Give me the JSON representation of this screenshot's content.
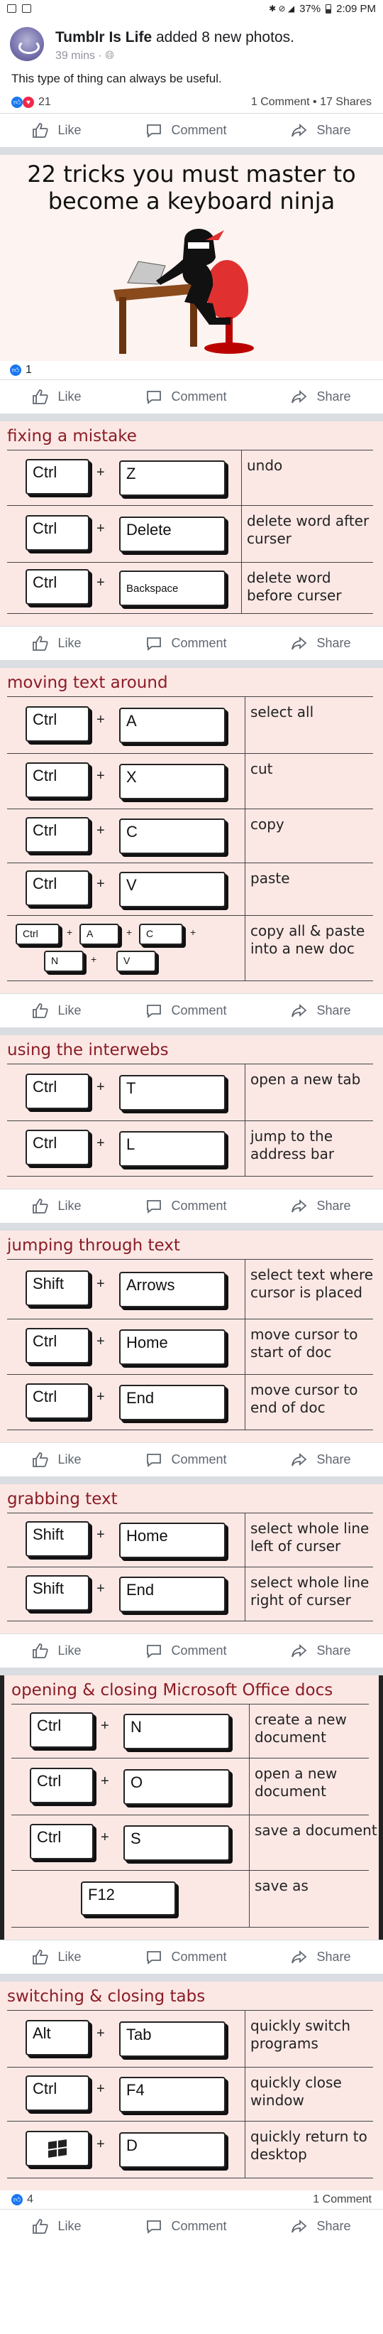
{
  "status_bar": {
    "battery": "37%",
    "time": "2:09 PM"
  },
  "post": {
    "author": "Tumblr Is Life",
    "action": "added 8 new photos.",
    "time": "39 mins · ",
    "text": "This type of thing can always be useful.",
    "reactions": "21",
    "stats": "1 Comment • 17 Shares"
  },
  "actions": {
    "like": "Like",
    "comment": "Comment",
    "share": "Share"
  },
  "banner": {
    "title": "22 tricks you must master to become a keyboard ninja",
    "likes": "1"
  },
  "sections": [
    {
      "title": "fixing a mistake",
      "rows": [
        {
          "keys": [
            "Ctrl",
            "Z"
          ],
          "desc": "undo"
        },
        {
          "keys": [
            "Ctrl",
            "Delete"
          ],
          "desc": "delete word after curser"
        },
        {
          "keys": [
            "Ctrl",
            "Backspace"
          ],
          "desc": "delete word before curser"
        }
      ]
    },
    {
      "title": "moving text around",
      "rows": [
        {
          "keys": [
            "Ctrl",
            "A"
          ],
          "desc": "select all"
        },
        {
          "keys": [
            "Ctrl",
            "X"
          ],
          "desc": "cut"
        },
        {
          "keys": [
            "Ctrl",
            "C"
          ],
          "desc": "copy"
        },
        {
          "keys": [
            "Ctrl",
            "V"
          ],
          "desc": "paste"
        },
        {
          "keys": [
            "Ctrl",
            "A",
            "C",
            "N",
            "V"
          ],
          "desc": "copy all & paste into a new doc"
        }
      ]
    },
    {
      "title": "using the interwebs",
      "rows": [
        {
          "keys": [
            "Ctrl",
            "T"
          ],
          "desc": "open a new tab"
        },
        {
          "keys": [
            "Ctrl",
            "L"
          ],
          "desc": "jump to the address bar"
        }
      ]
    },
    {
      "title": "jumping through text",
      "rows": [
        {
          "keys": [
            "Shift",
            "Arrows"
          ],
          "desc": "select text where cursor is placed"
        },
        {
          "keys": [
            "Ctrl",
            "Home"
          ],
          "desc": "move cursor to start of doc"
        },
        {
          "keys": [
            "Ctrl",
            "End"
          ],
          "desc": "move cursor to end of doc"
        }
      ]
    },
    {
      "title": "grabbing text",
      "rows": [
        {
          "keys": [
            "Shift",
            "Home"
          ],
          "desc": "select whole line left of curser"
        },
        {
          "keys": [
            "Shift",
            "End"
          ],
          "desc": "select whole line right of curser"
        }
      ]
    },
    {
      "title": "opening & closing Microsoft Office docs",
      "rows": [
        {
          "keys": [
            "Ctrl",
            "N"
          ],
          "desc": "create a new document"
        },
        {
          "keys": [
            "Ctrl",
            "O"
          ],
          "desc": "open a new document"
        },
        {
          "keys": [
            "Ctrl",
            "S"
          ],
          "desc": "save a document"
        },
        {
          "keys": [
            "F12"
          ],
          "desc": "save as"
        }
      ]
    },
    {
      "title": "switching & closing tabs",
      "rows": [
        {
          "keys": [
            "Alt",
            "Tab"
          ],
          "desc": "quickly switch programs"
        },
        {
          "keys": [
            "Ctrl",
            "F4"
          ],
          "desc": "quickly close window"
        },
        {
          "keys": [
            "win",
            "D"
          ],
          "desc": "quickly return to desktop"
        }
      ]
    }
  ],
  "final": {
    "likes": "4",
    "comments": "1 Comment"
  }
}
